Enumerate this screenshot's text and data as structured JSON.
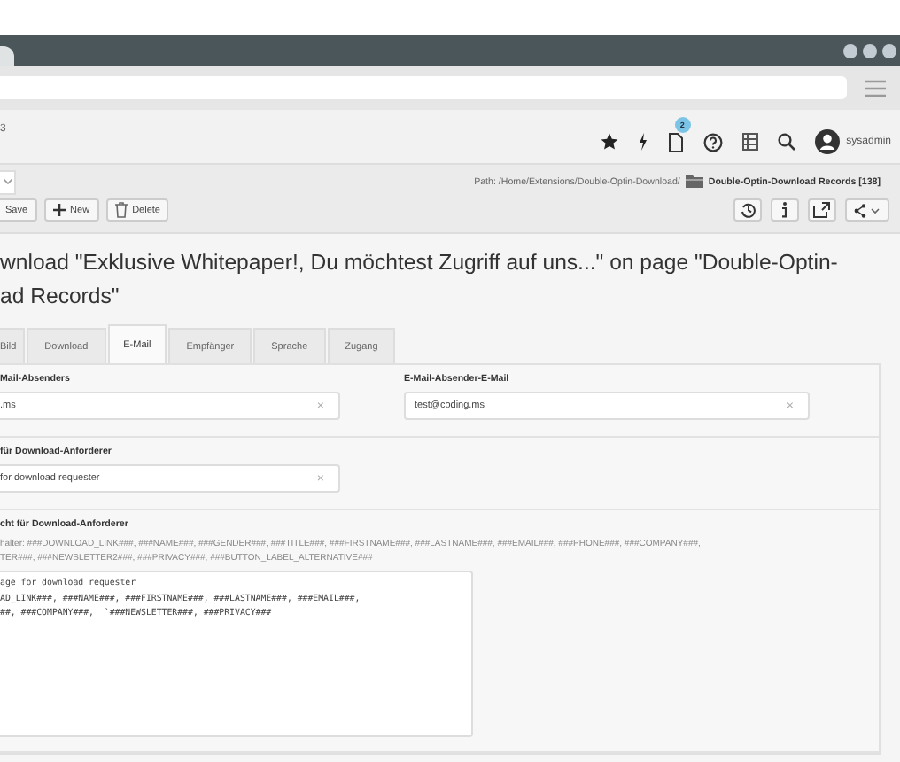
{
  "topbar": {
    "site_text": "3",
    "badge": "2",
    "user": "sysadmin"
  },
  "docheader": {
    "path_prefix": "Path: /Home/Extensions/Double-Optin-Download/",
    "path_page": "Double-Optin-Download Records [138]",
    "buttons": [
      {
        "kind": "save",
        "label": "Save"
      },
      {
        "kind": "new",
        "label": "New"
      },
      {
        "kind": "delete",
        "label": "Delete"
      }
    ]
  },
  "title": "wnload \"Exklusive Whitepaper!, Du möchtest Zugriff auf uns...\" on page \"Double-Optin-\nad Records\"",
  "tabs": [
    {
      "label": "Bild",
      "selected": false
    },
    {
      "label": "Download",
      "selected": false
    },
    {
      "label": "E-Mail",
      "selected": true
    },
    {
      "label": "Empfänger",
      "selected": false
    },
    {
      "label": "Sprache",
      "selected": false
    },
    {
      "label": "Zugang",
      "selected": false
    }
  ],
  "fields_row": [
    {
      "label": "Mail-Absenders",
      "value": ".ms",
      "clear": "×"
    },
    {
      "label": "E-Mail-Absender-E-Mail",
      "value": "test@coding.ms",
      "clear": "×"
    }
  ],
  "subject_field": {
    "label": "für Download-Anforderer",
    "value": "for download requester",
    "clear": "×"
  },
  "message_field": {
    "label": "cht für Download-Anforderer",
    "hint": [
      "halter: ###DOWNLOAD_LINK###, ###NAME###, ###GENDER###, ###TITLE###, ###FIRSTNAME###, ###LASTNAME###, ###EMAIL###, ###PHONE###, ###COMPANY###,",
      "TER###, ###NEWSLETTER2###, ###PRIVACY###, ###BUTTON_LABEL_ALTERNATIVE###"
    ],
    "value": "age for download requester\nAD_LINK###, ###NAME###, ###FIRSTNAME###, ###LASTNAME###, ###EMAIL###,\n##, ###COMPANY###,  `###NEWSLETTER###, ###PRIVACY###"
  }
}
